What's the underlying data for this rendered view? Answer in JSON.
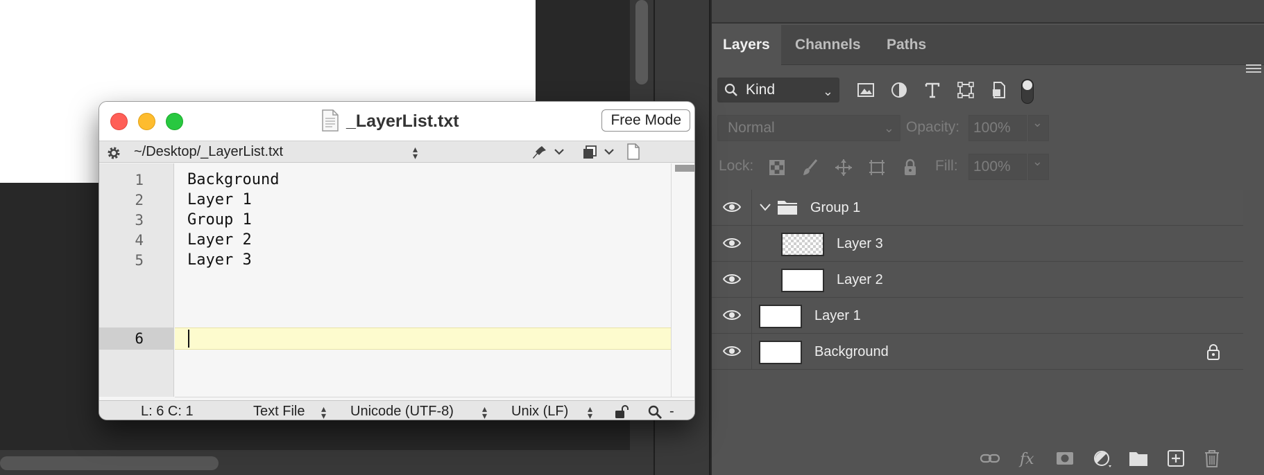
{
  "editor": {
    "title": "_LayerList.txt",
    "mode_button": "Free Mode",
    "path": "~/Desktop/_LayerList.txt",
    "lines": [
      {
        "number": "1",
        "text": "Background"
      },
      {
        "number": "2",
        "text": "Layer 1"
      },
      {
        "number": "3",
        "text": "Group 1"
      },
      {
        "number": "4",
        "text": "Layer 2"
      },
      {
        "number": "5",
        "text": "Layer 3"
      },
      {
        "number": "6",
        "text": ""
      }
    ],
    "status": {
      "position": "L: 6 C: 1",
      "file_type": "Text File",
      "encoding": "Unicode (UTF-8)",
      "line_endings": "Unix (LF)",
      "dash": "-"
    }
  },
  "layers_panel": {
    "tabs": [
      {
        "label": "Layers",
        "active": true
      },
      {
        "label": "Channels",
        "active": false
      },
      {
        "label": "Paths",
        "active": false
      }
    ],
    "filter": {
      "kind": "Kind"
    },
    "blend": {
      "mode": "Normal",
      "opacity_label": "Opacity:",
      "opacity_value": "100%"
    },
    "lock": {
      "label": "Lock:",
      "fill_label": "Fill:",
      "fill_value": "100%"
    },
    "layers": [
      {
        "name": "Group 1",
        "type": "group",
        "visible": true,
        "indent": 0
      },
      {
        "name": "Layer 3",
        "type": "layer",
        "visible": true,
        "indent": 1,
        "transparent": true
      },
      {
        "name": "Layer 2",
        "type": "layer",
        "visible": true,
        "indent": 1,
        "transparent": false
      },
      {
        "name": "Layer 1",
        "type": "layer",
        "visible": true,
        "indent": 0,
        "transparent": false
      },
      {
        "name": "Background",
        "type": "layer",
        "visible": true,
        "indent": 0,
        "transparent": false,
        "locked": true
      }
    ],
    "footer_icons": [
      "link-icon",
      "fx-icon",
      "mask-icon",
      "adjustment-icon",
      "folder-icon",
      "new-layer-icon",
      "trash-icon"
    ]
  },
  "colors": {
    "close": "#ff5f57",
    "minimize": "#febc2e",
    "maximize": "#28c840",
    "current_line": "#fdfbce",
    "panel_bg": "#535353"
  }
}
